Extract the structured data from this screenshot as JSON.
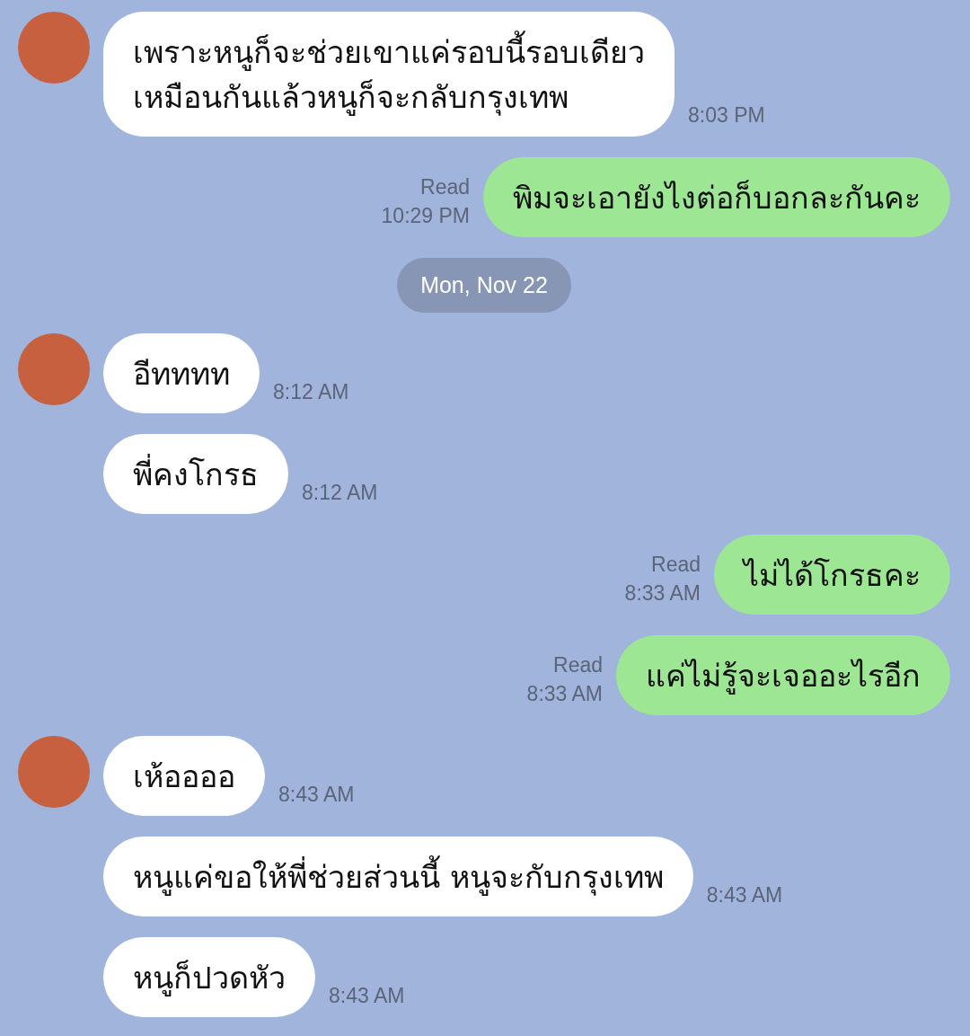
{
  "messages": [
    {
      "kind": "incoming",
      "avatar": true,
      "text": "เพราะหนูก็จะช่วยเขาแค่รอบนี้รอบเดียว\nเหมือนกันแล้วหนูก็จะกลับกรุงเทพ",
      "time": "8:03 PM"
    },
    {
      "kind": "outgoing",
      "read": "Read",
      "text": "พิมจะเอายังไงต่อก็บอกละกันคะ",
      "time": "10:29 PM"
    },
    {
      "kind": "date",
      "text": "Mon, Nov 22"
    },
    {
      "kind": "incoming",
      "avatar": true,
      "text": "อีทททท",
      "time": "8:12 AM"
    },
    {
      "kind": "incoming",
      "avatar": false,
      "text": "พี่คงโกรธ",
      "time": "8:12 AM"
    },
    {
      "kind": "outgoing",
      "read": "Read",
      "text": "ไม่ได้โกรธคะ",
      "time": "8:33 AM"
    },
    {
      "kind": "outgoing",
      "read": "Read",
      "text": "แค่ไม่รู้จะเจออะไรอีก",
      "time": "8:33 AM"
    },
    {
      "kind": "incoming",
      "avatar": true,
      "text": "เห้ออออ",
      "time": "8:43 AM"
    },
    {
      "kind": "incoming",
      "avatar": false,
      "text": "หนูแค่ขอให้พี่ช่วยส่วนนี้ หนูจะกับกรุงเทพ",
      "time": "8:43 AM"
    },
    {
      "kind": "incoming",
      "avatar": false,
      "text": "หนูก็ปวดหัว",
      "time": "8:43 AM"
    }
  ]
}
